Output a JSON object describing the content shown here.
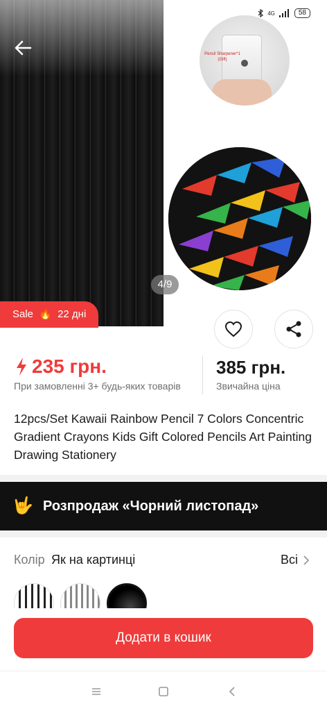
{
  "status_bar": {
    "network": "4G",
    "battery": "58"
  },
  "gallery": {
    "counter": "4/9",
    "sharpener_label": "Pencil Sharpener*1 (Gift)"
  },
  "sale_badge": {
    "label": "Sale",
    "days": "22 дні"
  },
  "price": {
    "current": "235 грн.",
    "current_note": "При замовленні 3+ будь-яких товарів",
    "regular": "385 грн.",
    "regular_note": "Звичайна ціна"
  },
  "product": {
    "title": "12pcs/Set Kawaii Rainbow Pencil 7 Colors Concentric Gradient Crayons Kids Gift Colored Pencils Art Painting Drawing Stationery"
  },
  "promo": {
    "text": "Розпродаж «Чорний листопад»"
  },
  "color": {
    "label": "Колір",
    "value": "Як на картинці",
    "all_label": "Всі"
  },
  "cart": {
    "button_label": "Додати в кошик"
  },
  "colors": {
    "accent": "#ef3b3b",
    "promo_bg": "#111111"
  },
  "icons": [
    "back-arrow-icon",
    "heart-icon",
    "share-icon",
    "lightning-icon",
    "chevron-right-icon",
    "menu-icon",
    "home-icon",
    "back-icon"
  ]
}
